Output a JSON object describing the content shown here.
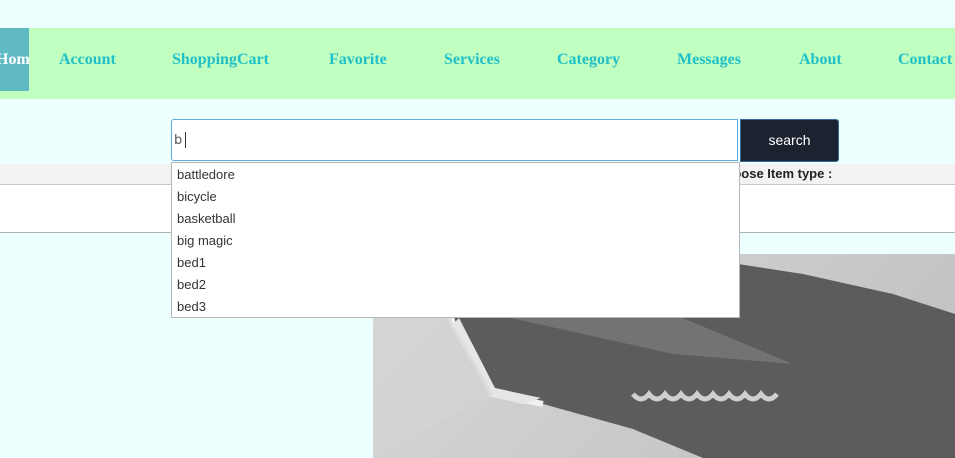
{
  "nav": {
    "active_label": "Home",
    "items": [
      {
        "label": "Account"
      },
      {
        "label": "ShoppingCart"
      },
      {
        "label": "Favorite"
      },
      {
        "label": "Services"
      },
      {
        "label": "Category"
      },
      {
        "label": "Messages"
      },
      {
        "label": "About"
      },
      {
        "label": "Contact"
      }
    ]
  },
  "search": {
    "value": "b",
    "button_label": "search"
  },
  "filter": {
    "choose_label": "Choose Item type :"
  },
  "suggestions": [
    "battledore",
    "bicycle",
    "basketball",
    "big magic",
    "bed1",
    "bed2",
    "bed3"
  ],
  "product": {
    "image_icon": "knife-blade-image"
  },
  "colors": {
    "nav_bg": "#c0ffc0",
    "nav_active": "#5fbac4",
    "nav_text": "#20c0c8",
    "page_bg": "#eeffff",
    "search_button": "#1c2330"
  }
}
